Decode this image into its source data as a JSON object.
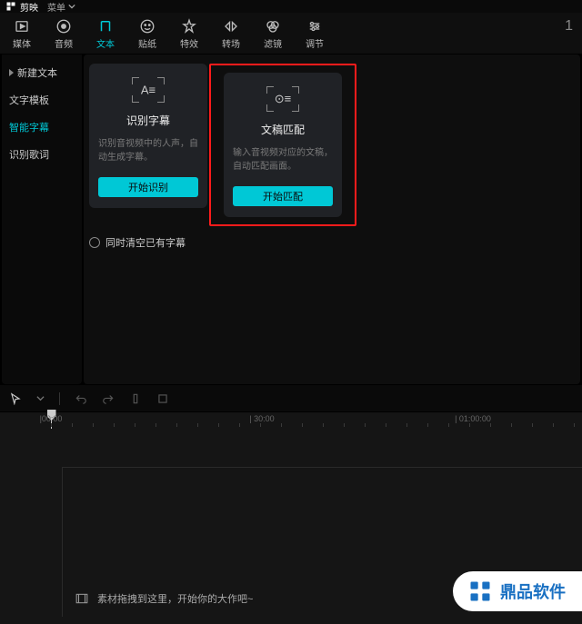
{
  "titlebar": {
    "appName": "剪映",
    "menuLabel": "菜单"
  },
  "toolbar": {
    "items": [
      {
        "label": "媒体"
      },
      {
        "label": "音频"
      },
      {
        "label": "文本"
      },
      {
        "label": "贴纸"
      },
      {
        "label": "特效"
      },
      {
        "label": "转场"
      },
      {
        "label": "滤镜"
      },
      {
        "label": "调节"
      }
    ],
    "page": "1"
  },
  "sidebar": {
    "items": [
      {
        "label": "新建文本"
      },
      {
        "label": "文字模板"
      },
      {
        "label": "智能字幕"
      },
      {
        "label": "识别歌词"
      }
    ]
  },
  "cards": {
    "recognize": {
      "title": "识别字幕",
      "desc": "识别音视频中的人声，自动生成字幕。",
      "button": "开始识别"
    },
    "match": {
      "title": "文稿匹配",
      "desc": "输入音视频对应的文稿，自动匹配画面。",
      "button": "开始匹配"
    }
  },
  "checkbox": {
    "label": "同时清空已有字幕"
  },
  "timeline": {
    "ruler": [
      {
        "label": "|00:00",
        "pos": 56
      },
      {
        "label": "| 30:00",
        "pos": 288
      },
      {
        "label": "| 01:00:00",
        "pos": 520
      }
    ],
    "dropHint": "素材拖拽到这里，开始你的大作吧~"
  },
  "watermark": {
    "text": "鼎品软件"
  }
}
